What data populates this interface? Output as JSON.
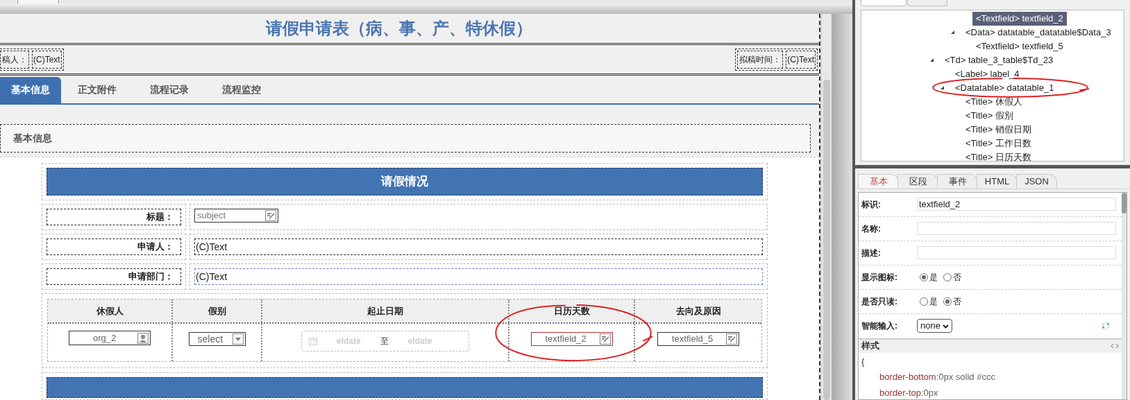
{
  "window": {
    "title": "请假申请表（病、事、产、特休假）"
  },
  "header_fields": [
    {
      "label": "稿人：",
      "value": "(C)Text"
    },
    {
      "label": "拟稿时间：",
      "value": "(C)Text"
    }
  ],
  "tabs": [
    {
      "label": "基本信息",
      "selected": true
    },
    {
      "label": "正文附件",
      "selected": false
    },
    {
      "label": "流程记录",
      "selected": false
    },
    {
      "label": "流程监控",
      "selected": false
    }
  ],
  "section": {
    "title": "基本信息"
  },
  "form": {
    "header": "请假情况",
    "fields": [
      {
        "label": "标题：",
        "kind": "textfield",
        "placeholder": "subject"
      },
      {
        "label": "申请人：",
        "kind": "text",
        "value": "(C)Text",
        "highlighted": false
      },
      {
        "label": "申请部门：",
        "kind": "text",
        "value": "(C)Text",
        "highlighted": true
      }
    ]
  },
  "datatable": {
    "columns": [
      "休假人",
      "假别",
      "起止日期",
      "日历天数",
      "去向及原因"
    ],
    "cells": [
      {
        "kind": "org",
        "value": "org_2",
        "circled": false
      },
      {
        "kind": "select",
        "value": "select",
        "circled": false
      },
      {
        "kind": "daterange",
        "from": "eldate",
        "separator": "至",
        "to": "eldate",
        "circled": false
      },
      {
        "kind": "textfield",
        "value": "textfield_2",
        "selected": true,
        "circled": true
      },
      {
        "kind": "textfield",
        "value": "textfield_5",
        "selected": false,
        "circled": false
      }
    ]
  },
  "component_tree": {
    "items": [
      {
        "children": [
          {
            "children": [
              {
                "children": [
                  {
                    "label": "<Textfield> textfield_2",
                    "selected": true
                  }
                ]
              },
              {
                "label": "<Data> datatable_datatable$Data_3",
                "expanded": true,
                "selected": false,
                "children": [
                  {
                    "label": "<Textfield> textfield_5",
                    "selected": false
                  }
                ]
              }
            ]
          }
        ]
      },
      {
        "label": "<Td> table_3_table$Td_23",
        "expanded": true,
        "selected": false,
        "children": [
          {
            "label": "<Label> label_4",
            "selected": false
          },
          {
            "label": "<Datatable> datatable_1",
            "expanded": true,
            "selected": false,
            "circled": true,
            "children": [
              {
                "label": "<Title> 休假人",
                "selected": false
              },
              {
                "label": "<Title> 假别",
                "selected": false
              },
              {
                "label": "<Title> 销假日期",
                "selected": false
              },
              {
                "label": "<Title> 工作日数",
                "selected": false
              },
              {
                "label": "<Title> 日历天数",
                "selected": false
              }
            ]
          }
        ]
      }
    ]
  },
  "properties": {
    "tabs": [
      {
        "label": "基本",
        "selected": true
      },
      {
        "label": "区段",
        "selected": false
      },
      {
        "label": "事件",
        "selected": false
      },
      {
        "label": "HTML",
        "selected": false
      },
      {
        "label": "JSON",
        "selected": false
      }
    ],
    "fields": [
      {
        "label": "标识:",
        "kind": "input",
        "value": "textfield_2"
      },
      {
        "label": "名称:",
        "kind": "input"
      },
      {
        "label": "描述:",
        "kind": "input"
      },
      {
        "label": "显示图标:",
        "kind": "radio",
        "options": [
          {
            "label": "是",
            "selected": true
          },
          {
            "label": "否",
            "selected": false
          }
        ]
      },
      {
        "label": "是否只读:",
        "kind": "radio",
        "options": [
          {
            "label": "是",
            "selected": false
          },
          {
            "label": "否",
            "selected": true
          }
        ]
      },
      {
        "label": "智能输入:",
        "kind": "select",
        "value": "none"
      }
    ],
    "style": {
      "title": "样式",
      "lines": [
        {
          "kind": "brace",
          "text": "{"
        },
        {
          "kind": "rule",
          "name": "border-bottom",
          "value": ":0px solid #ccc"
        },
        {
          "kind": "rule",
          "name": "border-top",
          "value": ":0px"
        }
      ]
    }
  }
}
